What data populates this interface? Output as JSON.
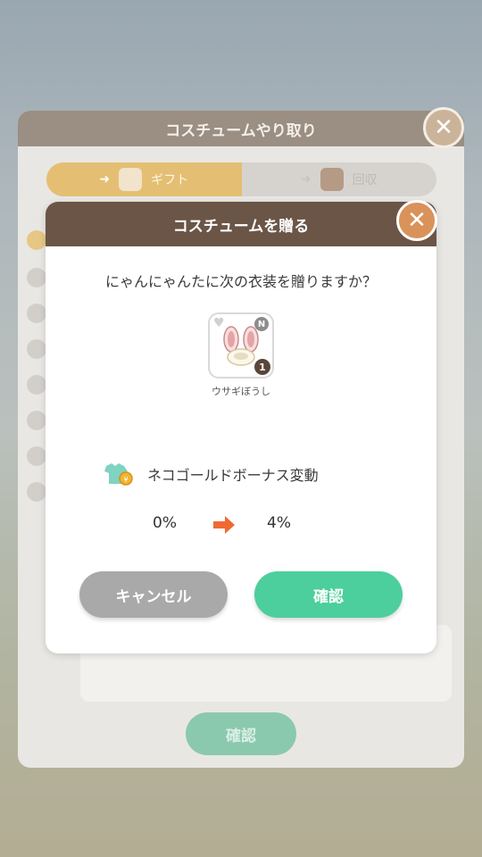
{
  "panel": {
    "title": "コスチュームやり取り",
    "tabs": [
      {
        "label": "ギフト",
        "active": true
      },
      {
        "label": "回収",
        "active": false
      }
    ],
    "confirm_label": "確認"
  },
  "modal": {
    "title": "コスチュームを贈る",
    "question": "にゃんにゃんたに次の衣装を贈りますか？",
    "item": {
      "name": "ウサギぼうし",
      "rarity": "N",
      "count": "1"
    },
    "bonus_label": "ネコゴールドボーナス変動",
    "percent_before": "0%",
    "percent_after": "4%",
    "cancel_label": "キャンセル",
    "confirm_label": "確認"
  },
  "colors": {
    "header_brown": "#6a5547",
    "confirm_green": "#4ccf9c",
    "cancel_gray": "#a9a9a9",
    "arrow_orange": "#ef6a33",
    "tab_gold": "#e4bf73"
  },
  "icons": {
    "close": "close-icon",
    "arrow": "arrow-right-icon",
    "heart": "heart-icon",
    "shirt": "shirt-coin-icon"
  }
}
